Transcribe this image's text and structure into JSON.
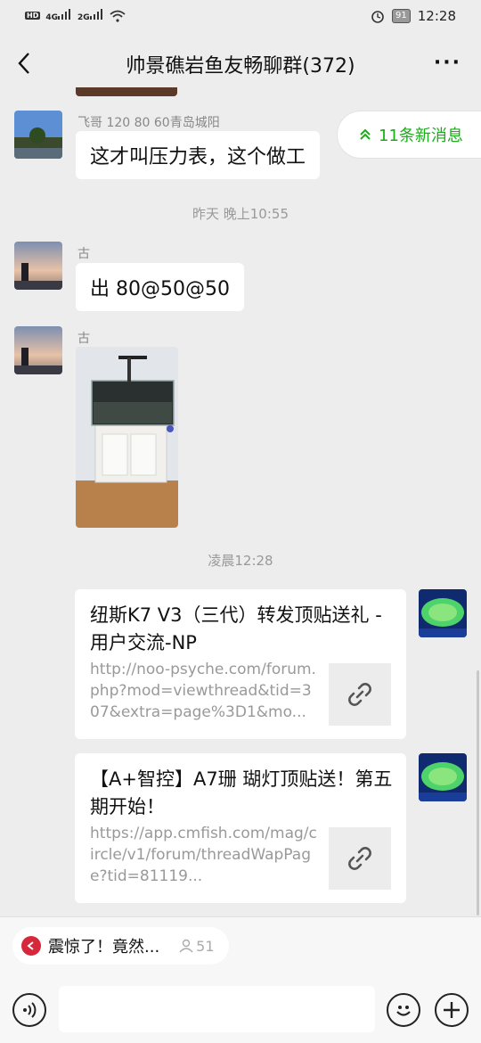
{
  "status_bar": {
    "hd_badge": "HD",
    "network1": "4G",
    "network2": "2G",
    "battery": "91",
    "time": "12:28"
  },
  "header": {
    "title": "帅景礁岩鱼友畅聊群(372)",
    "more": "···"
  },
  "new_messages": {
    "label": "11条新消息"
  },
  "messages": [
    {
      "sender": "飞哥 120 80 60青岛城阳",
      "text": "这才叫压力表，这个做工"
    },
    {
      "timestamp": "昨天 晚上10:55"
    },
    {
      "sender": "古",
      "text": "出 80@50@50"
    },
    {
      "sender": "古",
      "image": "aquarium-tank-photo"
    },
    {
      "timestamp": "凌晨12:28"
    }
  ],
  "links": [
    {
      "title": "纽斯K7 V3（三代）转发顶贴送礼 - 用户交流-NP",
      "desc": "http://noo-psyche.com/forum.php?mod=viewthread&tid=307&extra=page%3D1&mo..."
    },
    {
      "title": "【A+智控】A7珊 瑚灯顶贴送！第五期开始！",
      "desc": "https://app.cmfish.com/mag/circle/v1/forum/threadWapPage?tid=81119..."
    }
  ],
  "promo": {
    "text": "震惊了！竟然...",
    "count": "51"
  },
  "input": {
    "placeholder": ""
  },
  "colors": {
    "accent_green": "#1aad19",
    "bg": "#ededed",
    "promo_red": "#d6283a"
  }
}
